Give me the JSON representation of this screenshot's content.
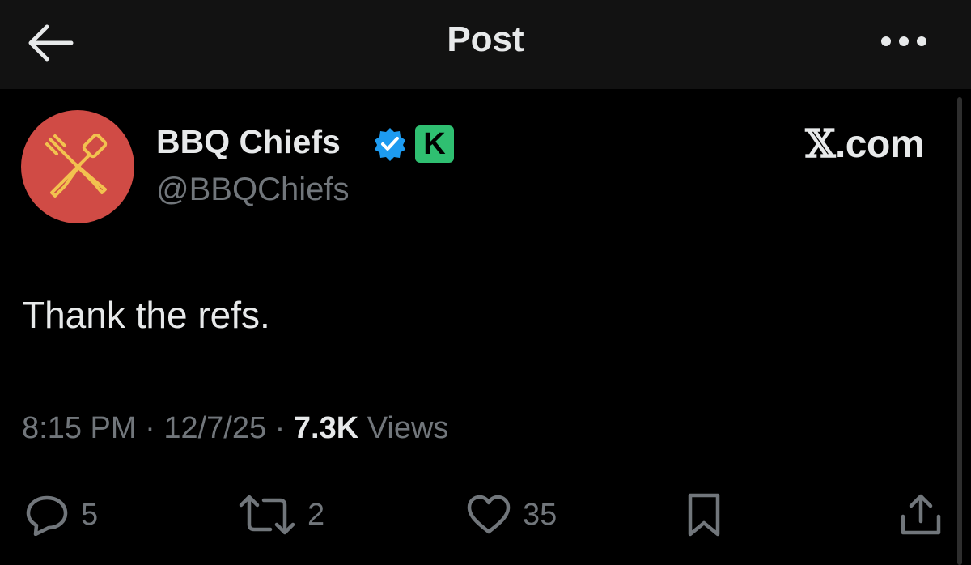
{
  "header": {
    "title": "Post"
  },
  "author": {
    "display_name": "BBQ Chiefs",
    "handle": "@BBQChiefs",
    "badge_letter": "K",
    "avatar_color": "#d04b45",
    "avatar_icon": "crossed-fork-spatula-icon",
    "verified_color": "#1d9bf0",
    "badge_color": "#2fbf71"
  },
  "source_brand": {
    "x_glyph": "𝕏",
    "domain": ".com"
  },
  "post": {
    "text": "Thank the refs.",
    "time": "8:15 PM",
    "separator": " · ",
    "date": "12/7/25",
    "views_count": "7.3K",
    "views_label": " Views"
  },
  "actions": {
    "replies": "5",
    "reposts": "2",
    "likes": "35"
  }
}
